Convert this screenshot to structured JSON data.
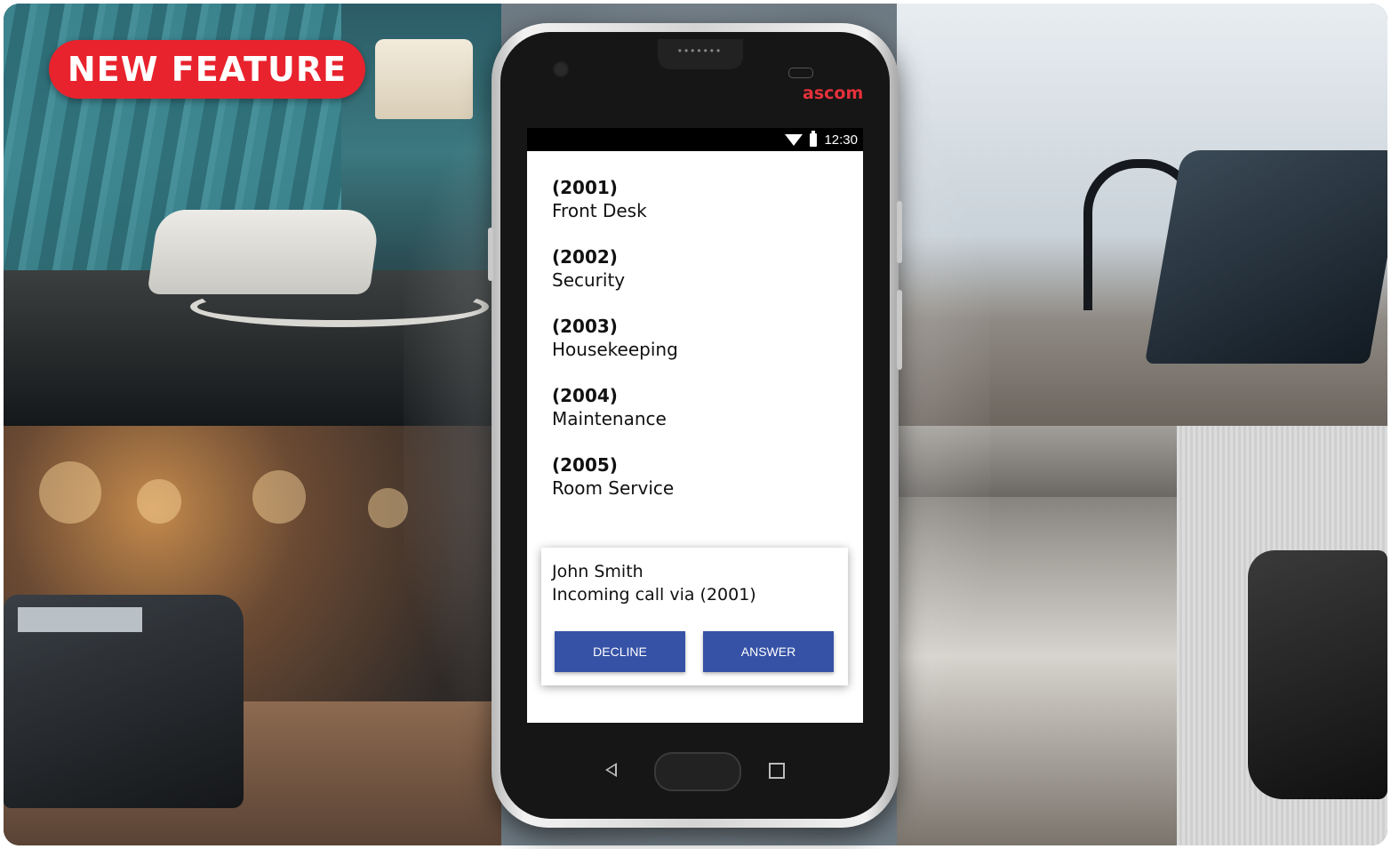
{
  "badge": {
    "label": "NEW FEATURE"
  },
  "device": {
    "brand": "ascom",
    "speaker": "•••••••",
    "status_bar": {
      "time": "12:30",
      "wifi_icon": "wifi-icon",
      "battery_icon": "battery-icon"
    },
    "contacts": [
      {
        "ext": "(2001)",
        "name": "Front Desk"
      },
      {
        "ext": "(2002)",
        "name": "Security"
      },
      {
        "ext": "(2003)",
        "name": "Housekeeping"
      },
      {
        "ext": "(2004)",
        "name": "Maintenance"
      },
      {
        "ext": "(2005)",
        "name": "Room Service"
      }
    ],
    "incoming_call": {
      "caller": "John Smith",
      "detail": "Incoming call via (2001)",
      "decline_label": "DECLINE",
      "answer_label": "ANSWER"
    },
    "nav": {
      "back_icon": "back-triangle-icon",
      "home_icon": "home-button",
      "recent_icon": "recent-square-icon"
    }
  },
  "colors": {
    "badge": "#e8232d",
    "brand": "#e5313b",
    "button": "#3652a6"
  }
}
